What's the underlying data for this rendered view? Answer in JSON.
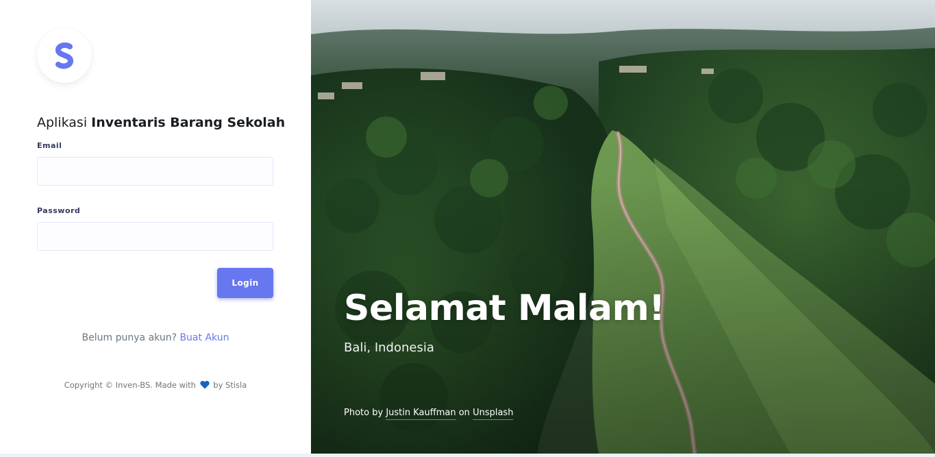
{
  "app": {
    "title_prefix": "Aplikasi",
    "title_strong": "Inventaris Barang Sekolah"
  },
  "form": {
    "email_label": "Email",
    "email_value": "",
    "password_label": "Password",
    "password_value": "",
    "login_label": "Login"
  },
  "signup": {
    "prompt": "Belum punya akun?",
    "link": "Buat Akun"
  },
  "footer": {
    "copyright_pre": "Copyright © Inven-BS. Made with",
    "copyright_post": "by Stisla",
    "heart_icon": "heart-icon"
  },
  "hero": {
    "greeting": "Selamat Malam!",
    "location": "Bali, Indonesia",
    "credit_pre": "Photo by",
    "credit_author": "Justin Kauffman",
    "credit_mid": "on",
    "credit_source": "Unsplash"
  },
  "colors": {
    "primary": "#6777ef",
    "heart": "#1565c0"
  }
}
